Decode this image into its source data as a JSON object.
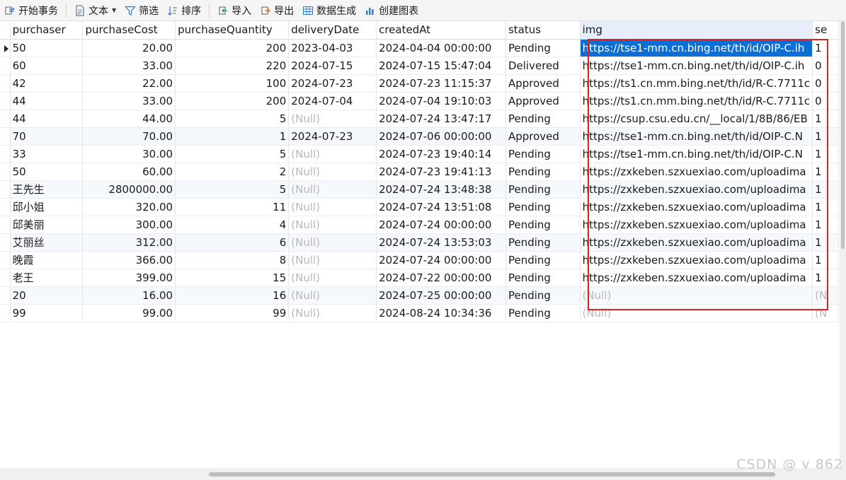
{
  "toolbar": {
    "begin_transaction": "开始事务",
    "text": "文本",
    "filter": "筛选",
    "sort": "排序",
    "import": "导入",
    "export": "导出",
    "generate_data": "数据生成",
    "create_chart": "创建图表"
  },
  "grid": {
    "columns": [
      "purchaser",
      "purchaseCost",
      "purchaseQuantity",
      "deliveryDate",
      "createdAt",
      "status",
      "img",
      "se"
    ],
    "rows": [
      [
        "50",
        "20.00",
        "200",
        "2023-04-03",
        "2024-04-04 00:00:00",
        "Pending",
        "https://tse1-mm.cn.bing.net/th/id/OIP-C.ih",
        "1"
      ],
      [
        "60",
        "33.00",
        "220",
        "2024-07-15",
        "2024-07-15 15:47:04",
        "Delivered",
        "https://tse1-mm.cn.bing.net/th/id/OIP-C.ih",
        "0"
      ],
      [
        "42",
        "22.00",
        "100",
        "2024-07-23",
        "2024-07-23 11:15:37",
        "Approved",
        "https://ts1.cn.mm.bing.net/th/id/R-C.7711c",
        "0"
      ],
      [
        "44",
        "33.00",
        "200",
        "2024-07-04",
        "2024-07-04 19:10:03",
        "Approved",
        "https://ts1.cn.mm.bing.net/th/id/R-C.7711c",
        "0"
      ],
      [
        "44",
        "44.00",
        "5",
        "(Null)",
        "2024-07-24 13:47:17",
        "Pending",
        "https://csup.csu.edu.cn/__local/1/8B/86/EB",
        "1"
      ],
      [
        "70",
        "70.00",
        "1",
        "2024-07-23",
        "2024-07-06 00:00:00",
        "Approved",
        "https://tse1-mm.cn.bing.net/th/id/OIP-C.N",
        "1"
      ],
      [
        "33",
        "30.00",
        "5",
        "(Null)",
        "2024-07-23 19:40:14",
        "Pending",
        "https://tse1-mm.cn.bing.net/th/id/OIP-C.N",
        "1"
      ],
      [
        "50",
        "60.00",
        "2",
        "(Null)",
        "2024-07-23 19:41:13",
        "Pending",
        "https://zxkeben.szxuexiao.com/uploadima",
        "1"
      ],
      [
        "王先生",
        "2800000.00",
        "5",
        "(Null)",
        "2024-07-24 13:48:38",
        "Pending",
        "https://zxkeben.szxuexiao.com/uploadima",
        "1"
      ],
      [
        "邱小姐",
        "320.00",
        "11",
        "(Null)",
        "2024-07-24 13:51:08",
        "Pending",
        "https://zxkeben.szxuexiao.com/uploadima",
        "1"
      ],
      [
        "邱美丽",
        "300.00",
        "4",
        "(Null)",
        "2024-07-24 00:00:00",
        "Pending",
        "https://zxkeben.szxuexiao.com/uploadima",
        "1"
      ],
      [
        "艾丽丝",
        "312.00",
        "6",
        "(Null)",
        "2024-07-24 13:53:03",
        "Pending",
        "https://zxkeben.szxuexiao.com/uploadima",
        "1"
      ],
      [
        "晚霞",
        "366.00",
        "8",
        "(Null)",
        "2024-07-24 00:00:00",
        "Pending",
        "https://zxkeben.szxuexiao.com/uploadima",
        "1"
      ],
      [
        "老王",
        "399.00",
        "15",
        "(Null)",
        "2024-07-22 00:00:00",
        "Pending",
        "https://zxkeben.szxuexiao.com/uploadima",
        "1"
      ],
      [
        "20",
        "16.00",
        "16",
        "(Null)",
        "2024-07-25 00:00:00",
        "Pending",
        "(Null)",
        "(N"
      ],
      [
        "99",
        "99.00",
        "99",
        "(Null)",
        "2024-08-24 10:34:36",
        "Pending",
        "(Null)",
        "(N"
      ]
    ]
  },
  "watermark": "CSDN @    v  862"
}
